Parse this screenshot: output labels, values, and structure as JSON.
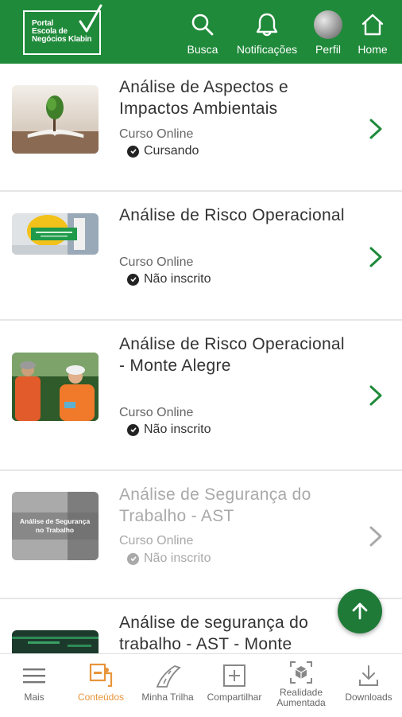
{
  "header": {
    "logo_text": "Portal\nEscola de\nNegócios Klabin",
    "nav": [
      {
        "label": "Busca",
        "icon": "search-icon"
      },
      {
        "label": "Notificações",
        "icon": "bell-icon"
      },
      {
        "label": "Perfil",
        "icon": "avatar"
      },
      {
        "label": "Home",
        "icon": "home-icon"
      }
    ]
  },
  "courses": [
    {
      "title": "Análise de Aspectos e Impactos Ambientais",
      "type": "Curso Online",
      "status": "Cursando",
      "enabled": true,
      "thumb": "tree-on-book"
    },
    {
      "title": "Análise de Risco Operacional",
      "type": "Curso Online",
      "status": "Não inscrito",
      "enabled": true,
      "thumb": "hard-hat-banner"
    },
    {
      "title": "Análise de Risco Operacional - Monte Alegre",
      "type": "Curso Online",
      "status": "Não inscrito",
      "enabled": true,
      "thumb": "workers-field"
    },
    {
      "title": "Análise de Segurança do Trabalho - AST",
      "type": "Curso Online",
      "status": "Não inscrito",
      "enabled": false,
      "thumb": "safety-grey",
      "thumb_text": "Análise de Segurança no Trabalho"
    },
    {
      "title": "Análise de segurança do trabalho - AST - Monte",
      "type": "",
      "status": "",
      "enabled": true,
      "thumb": "dark-green"
    }
  ],
  "bottom_nav": [
    {
      "label": "Mais",
      "icon": "menu-icon",
      "active": false
    },
    {
      "label": "Conteúdos",
      "icon": "contents-icon",
      "active": true
    },
    {
      "label": "Minha Trilha",
      "icon": "road-icon",
      "active": false
    },
    {
      "label": "Compartilhar",
      "icon": "plus-box-icon",
      "active": false
    },
    {
      "label": "Realidade\nAumentada",
      "icon": "ar-cube-icon",
      "active": false
    },
    {
      "label": "Downloads",
      "icon": "download-icon",
      "active": false
    }
  ],
  "colors": {
    "brand_green": "#1f8a3a",
    "fab_green": "#1f7a37",
    "active_orange": "#e8953a",
    "chevron_green": "#1f8a3a"
  }
}
